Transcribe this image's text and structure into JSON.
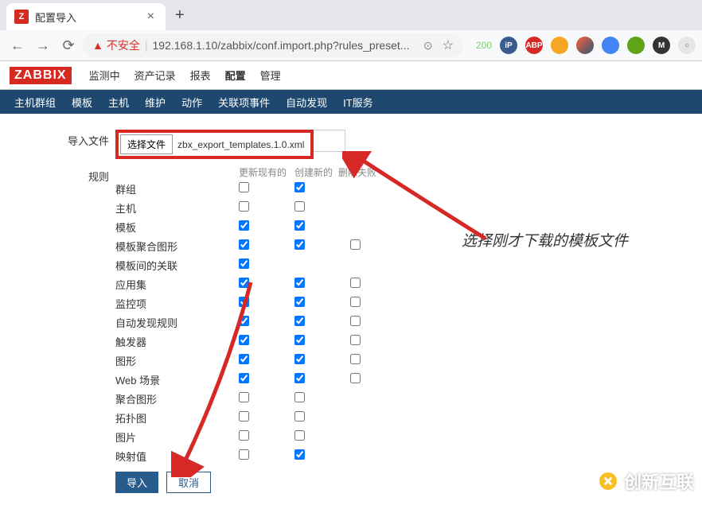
{
  "browser": {
    "tab_title": "配置导入",
    "insecure_label": "不安全",
    "url": "192.168.1.10/zabbix/conf.import.php?rules_preset...",
    "badge_200": "200"
  },
  "zabbix": {
    "logo": "ZABBIX",
    "top_menu": [
      "监测中",
      "资产记录",
      "报表",
      "配置",
      "管理"
    ],
    "sub_menu": [
      "主机群组",
      "模板",
      "主机",
      "维护",
      "动作",
      "关联项事件",
      "自动发现",
      "IT服务"
    ]
  },
  "form": {
    "import_file_label": "导入文件",
    "choose_btn": "选择文件",
    "file_name": "zbx_export_templates.1.0.xml",
    "rules_label": "规则",
    "col_update": "更新现有的",
    "col_create": "创建新的",
    "col_delete": "删除失败",
    "rows": [
      {
        "name": "群组",
        "c1": false,
        "c2": true,
        "c3": null
      },
      {
        "name": "主机",
        "c1": false,
        "c2": false,
        "c3": null
      },
      {
        "name": "模板",
        "c1": true,
        "c2": true,
        "c3": null
      },
      {
        "name": "模板聚合图形",
        "c1": true,
        "c2": true,
        "c3": false
      },
      {
        "name": "模板间的关联",
        "c1": true,
        "c2": null,
        "c3": null
      },
      {
        "name": "应用集",
        "c1": true,
        "c2": true,
        "c3": false
      },
      {
        "name": "监控项",
        "c1": true,
        "c2": true,
        "c3": false
      },
      {
        "name": "自动发现规则",
        "c1": true,
        "c2": true,
        "c3": false
      },
      {
        "name": "触发器",
        "c1": true,
        "c2": true,
        "c3": false
      },
      {
        "name": "图形",
        "c1": true,
        "c2": true,
        "c3": false
      },
      {
        "name": "Web 场景",
        "c1": true,
        "c2": true,
        "c3": false
      },
      {
        "name": "聚合图形",
        "c1": false,
        "c2": false,
        "c3": null
      },
      {
        "name": "拓扑图",
        "c1": false,
        "c2": false,
        "c3": null
      },
      {
        "name": "图片",
        "c1": false,
        "c2": false,
        "c3": null
      },
      {
        "name": "映射值",
        "c1": false,
        "c2": true,
        "c3": null
      }
    ],
    "import_btn": "导入",
    "cancel_btn": "取消"
  },
  "annotation": "选择刚才下载的模板文件",
  "watermark": "创新互联"
}
